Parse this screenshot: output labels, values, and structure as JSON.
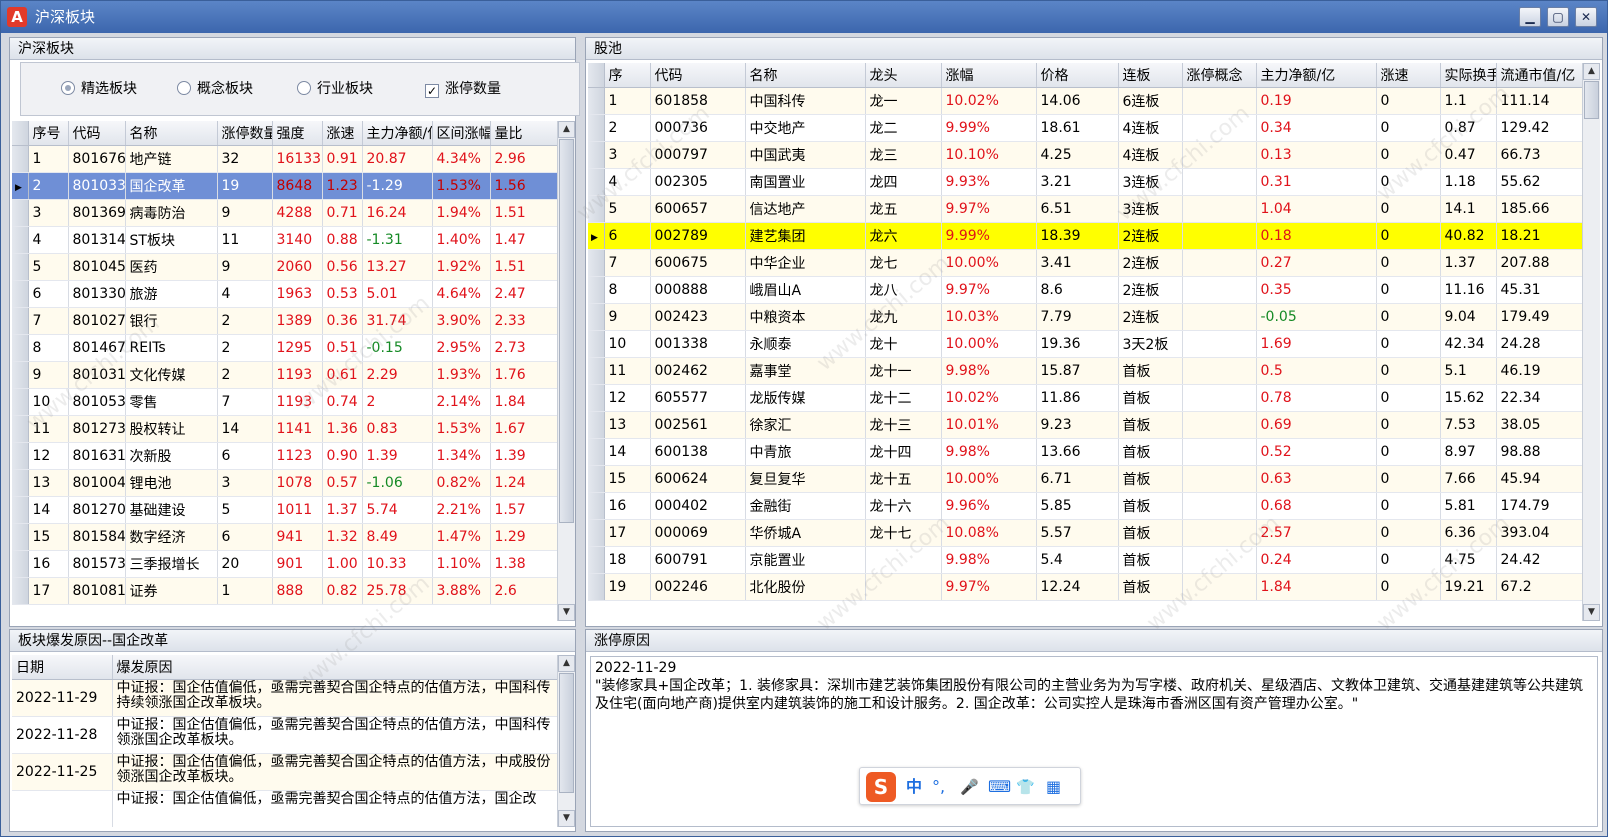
{
  "window": {
    "title": "沪深板块",
    "app_icon_letter": "A",
    "controls": {
      "minimize": "▁",
      "maximize": "▢",
      "close": "✕"
    }
  },
  "left_panel": {
    "title": "沪深板块",
    "options": {
      "featured": "精选板块",
      "concept": "概念板块",
      "industry": "行业板块",
      "limit_count": "涨停数量",
      "limit_count_checked": "✓"
    },
    "columns": [
      "序号",
      "代码",
      "名称",
      "涨停数量",
      "强度",
      "涨速",
      "主力净额/亿",
      "区间涨幅",
      "量比"
    ],
    "rows": [
      [
        "1",
        "801676",
        "地产链",
        "32",
        "16133",
        "0.91",
        "20.87",
        "4.34%",
        "2.96"
      ],
      [
        "2",
        "801033",
        "国企改革",
        "19",
        "8648",
        "1.23",
        "-1.29",
        "1.53%",
        "1.56"
      ],
      [
        "3",
        "801369",
        "病毒防治",
        "9",
        "4288",
        "0.71",
        "16.24",
        "1.94%",
        "1.51"
      ],
      [
        "4",
        "801314",
        "ST板块",
        "11",
        "3140",
        "0.88",
        "-1.31",
        "1.40%",
        "1.47"
      ],
      [
        "5",
        "801045",
        "医药",
        "9",
        "2060",
        "0.56",
        "13.27",
        "1.92%",
        "1.51"
      ],
      [
        "6",
        "801330",
        "旅游",
        "4",
        "1963",
        "0.53",
        "5.01",
        "4.64%",
        "2.47"
      ],
      [
        "7",
        "801027",
        "银行",
        "2",
        "1389",
        "0.36",
        "31.74",
        "3.90%",
        "2.33"
      ],
      [
        "8",
        "801467",
        "REITs",
        "2",
        "1295",
        "0.51",
        "-0.15",
        "2.95%",
        "2.73"
      ],
      [
        "9",
        "801031",
        "文化传媒",
        "2",
        "1193",
        "0.61",
        "2.29",
        "1.93%",
        "1.76"
      ],
      [
        "10",
        "801053",
        "零售",
        "7",
        "1193",
        "0.74",
        "2",
        "2.14%",
        "1.84"
      ],
      [
        "11",
        "801273",
        "股权转让",
        "14",
        "1141",
        "1.36",
        "0.83",
        "1.53%",
        "1.67"
      ],
      [
        "12",
        "801631",
        "次新股",
        "6",
        "1123",
        "0.90",
        "1.39",
        "1.34%",
        "1.39"
      ],
      [
        "13",
        "801004",
        "锂电池",
        "3",
        "1078",
        "0.57",
        "-1.06",
        "0.82%",
        "1.24"
      ],
      [
        "14",
        "801270",
        "基础建设",
        "5",
        "1011",
        "1.37",
        "5.74",
        "2.21%",
        "1.57"
      ],
      [
        "15",
        "801584",
        "数字经济",
        "6",
        "941",
        "1.32",
        "8.49",
        "1.47%",
        "1.29"
      ],
      [
        "16",
        "801573",
        "三季报增长",
        "20",
        "901",
        "1.00",
        "10.33",
        "1.10%",
        "1.38"
      ],
      [
        "17",
        "801081",
        "证券",
        "1",
        "888",
        "0.82",
        "25.78",
        "3.88%",
        "2.6"
      ]
    ]
  },
  "reason_panel": {
    "title": "板块爆发原因--国企改革",
    "columns": [
      "日期",
      "爆发原因"
    ],
    "rows": [
      [
        "2022-11-29",
        "中证报：国企估值偏低，亟需完善契合国企特点的估值方法，中国科传持续领涨国企改革板块。"
      ],
      [
        "2022-11-28",
        "中证报：国企估值偏低，亟需完善契合国企特点的估值方法，中国科传领涨国企改革板块。"
      ],
      [
        "2022-11-25",
        "中证报：国企估值偏低，亟需完善契合国企特点的估值方法，中成股份领涨国企改革板块。"
      ],
      [
        "",
        "中证报：国企估值偏低，亟需完善契合国企特点的估值方法，国企改"
      ]
    ]
  },
  "pool_panel": {
    "title": "股池",
    "columns": [
      "序",
      "代码",
      "名称",
      "龙头",
      "涨幅",
      "价格",
      "连板",
      "涨停概念",
      "主力净额/亿",
      "涨速",
      "实际换手",
      "流通市值/亿"
    ],
    "rows": [
      [
        "1",
        "601858",
        "中国科传",
        "龙一",
        "10.02%",
        "14.06",
        "6连板",
        "",
        "0.19",
        "0",
        "1.1",
        "111.14"
      ],
      [
        "2",
        "000736",
        "中交地产",
        "龙二",
        "9.99%",
        "18.61",
        "4连板",
        "",
        "0.34",
        "0",
        "0.87",
        "129.42"
      ],
      [
        "3",
        "000797",
        "中国武夷",
        "龙三",
        "10.10%",
        "4.25",
        "4连板",
        "",
        "0.13",
        "0",
        "0.47",
        "66.73"
      ],
      [
        "4",
        "002305",
        "南国置业",
        "龙四",
        "9.93%",
        "3.21",
        "3连板",
        "",
        "0.31",
        "0",
        "1.18",
        "55.62"
      ],
      [
        "5",
        "600657",
        "信达地产",
        "龙五",
        "9.97%",
        "6.51",
        "3连板",
        "",
        "1.04",
        "0",
        "14.1",
        "185.66"
      ],
      [
        "6",
        "002789",
        "建艺集团",
        "龙六",
        "9.99%",
        "18.39",
        "2连板",
        "",
        "0.18",
        "0",
        "40.82",
        "18.21"
      ],
      [
        "7",
        "600675",
        "中华企业",
        "龙七",
        "10.00%",
        "3.41",
        "2连板",
        "",
        "0.27",
        "0",
        "1.37",
        "207.88"
      ],
      [
        "8",
        "000888",
        "峨眉山A",
        "龙八",
        "9.97%",
        "8.6",
        "2连板",
        "",
        "0.35",
        "0",
        "11.16",
        "45.31"
      ],
      [
        "9",
        "002423",
        "中粮资本",
        "龙九",
        "10.03%",
        "7.79",
        "2连板",
        "",
        "-0.05",
        "0",
        "9.04",
        "179.49"
      ],
      [
        "10",
        "001338",
        "永顺泰",
        "龙十",
        "10.00%",
        "19.36",
        "3天2板",
        "",
        "1.69",
        "0",
        "42.34",
        "24.28"
      ],
      [
        "11",
        "002462",
        "嘉事堂",
        "龙十一",
        "9.98%",
        "15.87",
        "首板",
        "",
        "0.5",
        "0",
        "5.1",
        "46.19"
      ],
      [
        "12",
        "605577",
        "龙版传媒",
        "龙十二",
        "10.02%",
        "11.86",
        "首板",
        "",
        "0.78",
        "0",
        "15.62",
        "22.34"
      ],
      [
        "13",
        "002561",
        "徐家汇",
        "龙十三",
        "10.01%",
        "9.23",
        "首板",
        "",
        "0.69",
        "0",
        "7.53",
        "38.05"
      ],
      [
        "14",
        "600138",
        "中青旅",
        "龙十四",
        "9.98%",
        "13.66",
        "首板",
        "",
        "0.52",
        "0",
        "8.97",
        "98.88"
      ],
      [
        "15",
        "600624",
        "复旦复华",
        "龙十五",
        "10.00%",
        "6.71",
        "首板",
        "",
        "0.63",
        "0",
        "7.66",
        "45.94"
      ],
      [
        "16",
        "000402",
        "金融街",
        "龙十六",
        "9.96%",
        "5.85",
        "首板",
        "",
        "0.68",
        "0",
        "5.81",
        "174.79"
      ],
      [
        "17",
        "000069",
        "华侨城A",
        "龙十七",
        "10.08%",
        "5.57",
        "首板",
        "",
        "2.57",
        "0",
        "6.36",
        "393.04"
      ],
      [
        "18",
        "600791",
        "京能置业",
        "",
        "9.98%",
        "5.4",
        "首板",
        "",
        "0.24",
        "0",
        "4.75",
        "24.42"
      ],
      [
        "19",
        "002246",
        "北化股份",
        "",
        "9.97%",
        "12.24",
        "首板",
        "",
        "1.84",
        "0",
        "19.21",
        "67.2"
      ]
    ]
  },
  "limit_reason_panel": {
    "title": "涨停原因",
    "date": "2022-11-29",
    "text": "\"装修家具+国企改革；1. 装修家具：深圳市建艺装饰集团股份有限公司的主营业务为为写字楼、政府机关、星级酒店、文教体卫建筑、交通基建建筑等公共建筑及住宅(面向地产商)提供室内建筑装饰的施工和设计服务。2. 国企改革：公司实控人是珠海市香洲区国有资产管理办公室。\""
  },
  "ime_toolbar": {
    "logo": "S",
    "lang": "中",
    "punct": "°,",
    "mic": "🎤",
    "keyboard": "⌨",
    "skin": "👕",
    "apps": "▦"
  },
  "watermark": "www.cfchi.com",
  "colors": {
    "up": "#e0121a",
    "down": "#158a25",
    "selected_row": "#6f8fd6",
    "highlight_row": "#ffff00"
  }
}
